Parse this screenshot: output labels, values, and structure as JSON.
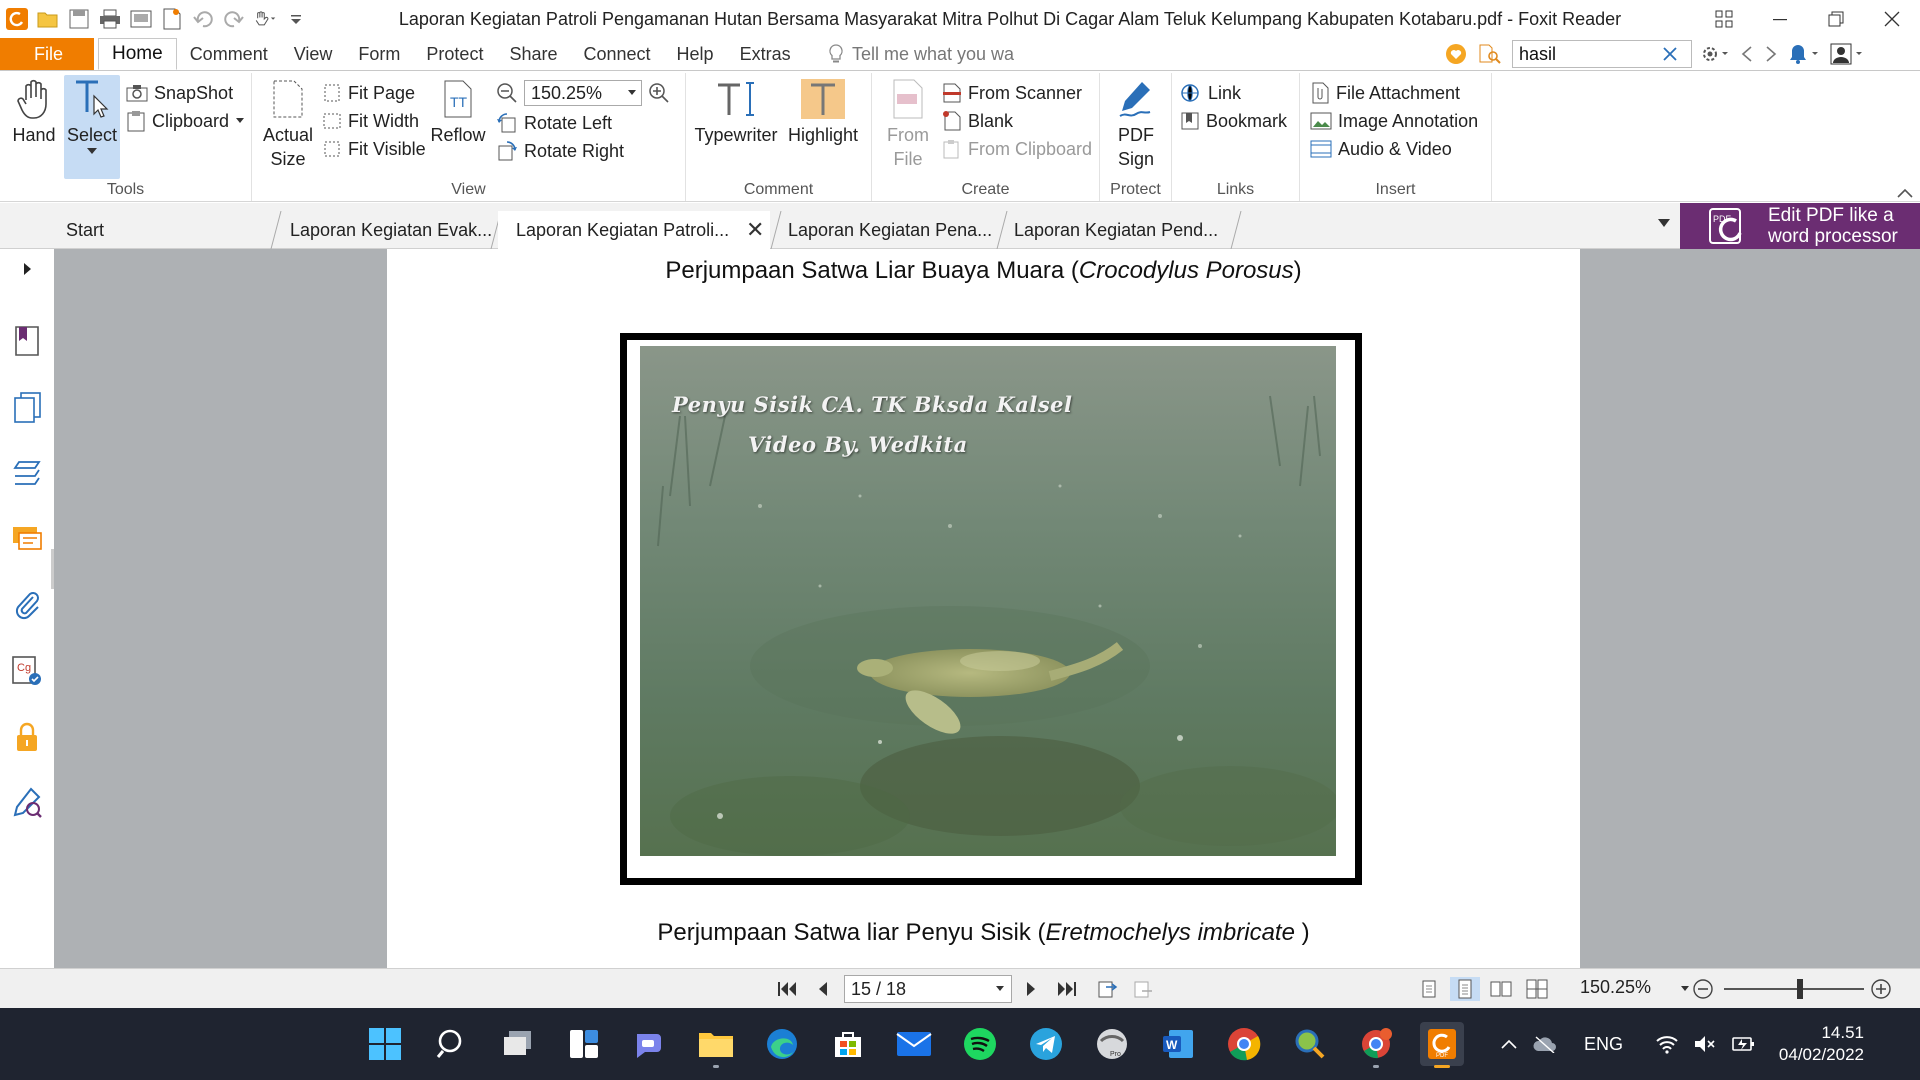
{
  "window": {
    "title": "Laporan Kegiatan Patroli Pengamanan Hutan Bersama Masyarakat Mitra Polhut Di Cagar Alam Teluk Kelumpang Kabupaten Kotabaru.pdf - Foxit Reader"
  },
  "menu": {
    "file": "File",
    "tabs": [
      "Home",
      "Comment",
      "View",
      "Form",
      "Protect",
      "Share",
      "Connect",
      "Help",
      "Extras"
    ],
    "tell_me": "Tell me what you wa",
    "search_value": "hasil"
  },
  "ribbon": {
    "tools": {
      "hand": "Hand",
      "select": "Select",
      "snapshot": "SnapShot",
      "clipboard": "Clipboard",
      "label": "Tools"
    },
    "view": {
      "actual_size_1": "Actual",
      "actual_size_2": "Size",
      "fit_page": "Fit Page",
      "fit_width": "Fit Width",
      "fit_visible": "Fit Visible",
      "reflow": "Reflow",
      "zoom": "150.25%",
      "rotate_left": "Rotate Left",
      "rotate_right": "Rotate Right",
      "label": "View"
    },
    "comment": {
      "typewriter": "Typewriter",
      "highlight": "Highlight",
      "label": "Comment"
    },
    "create": {
      "from_file_1": "From",
      "from_file_2": "File",
      "from_scanner": "From Scanner",
      "blank": "Blank",
      "from_clipboard": "From Clipboard",
      "label": "Create"
    },
    "protect": {
      "pdf_sign_1": "PDF",
      "pdf_sign_2": "Sign",
      "label": "Protect"
    },
    "links": {
      "link": "Link",
      "bookmark": "Bookmark",
      "label": "Links"
    },
    "insert": {
      "file_attachment": "File Attachment",
      "image_annotation": "Image Annotation",
      "audio_video": "Audio & Video",
      "label": "Insert"
    }
  },
  "doc_tabs": [
    {
      "label": "Start"
    },
    {
      "label": "Laporan Kegiatan Evak..."
    },
    {
      "label": "Laporan Kegiatan Patroli..."
    },
    {
      "label": "Laporan Kegiatan Pena..."
    },
    {
      "label": "Laporan Kegiatan Pend..."
    }
  ],
  "tab_close": "✕",
  "ad": {
    "line1": "Edit PDF like a",
    "line2": "word processor"
  },
  "page": {
    "caption_top_prefix": "Perjumpaan Satwa Liar Buaya Muara (",
    "caption_top_italic": "Crocodylus Porosus",
    "caption_top_suffix": ")",
    "photo_watermark_1": "Penyu Sisik CA. TK Bksda Kalsel",
    "photo_watermark_2": "Video By. Wedkita",
    "caption_bottom_prefix": "Perjumpaan Satwa liar Penyu Sisik (",
    "caption_bottom_italic": "Eretmochelys imbricate",
    "caption_bottom_suffix": " )"
  },
  "status": {
    "page_indicator": "15 / 18",
    "zoom": "150.25%"
  },
  "taskbar": {
    "language": "ENG",
    "time": "14.51",
    "date": "04/02/2022"
  },
  "colors": {
    "accent_orange": "#f07d00",
    "ad_purple": "#6b2d72",
    "taskbar": "#1f2430",
    "view_bg": "#aeb1b4"
  }
}
